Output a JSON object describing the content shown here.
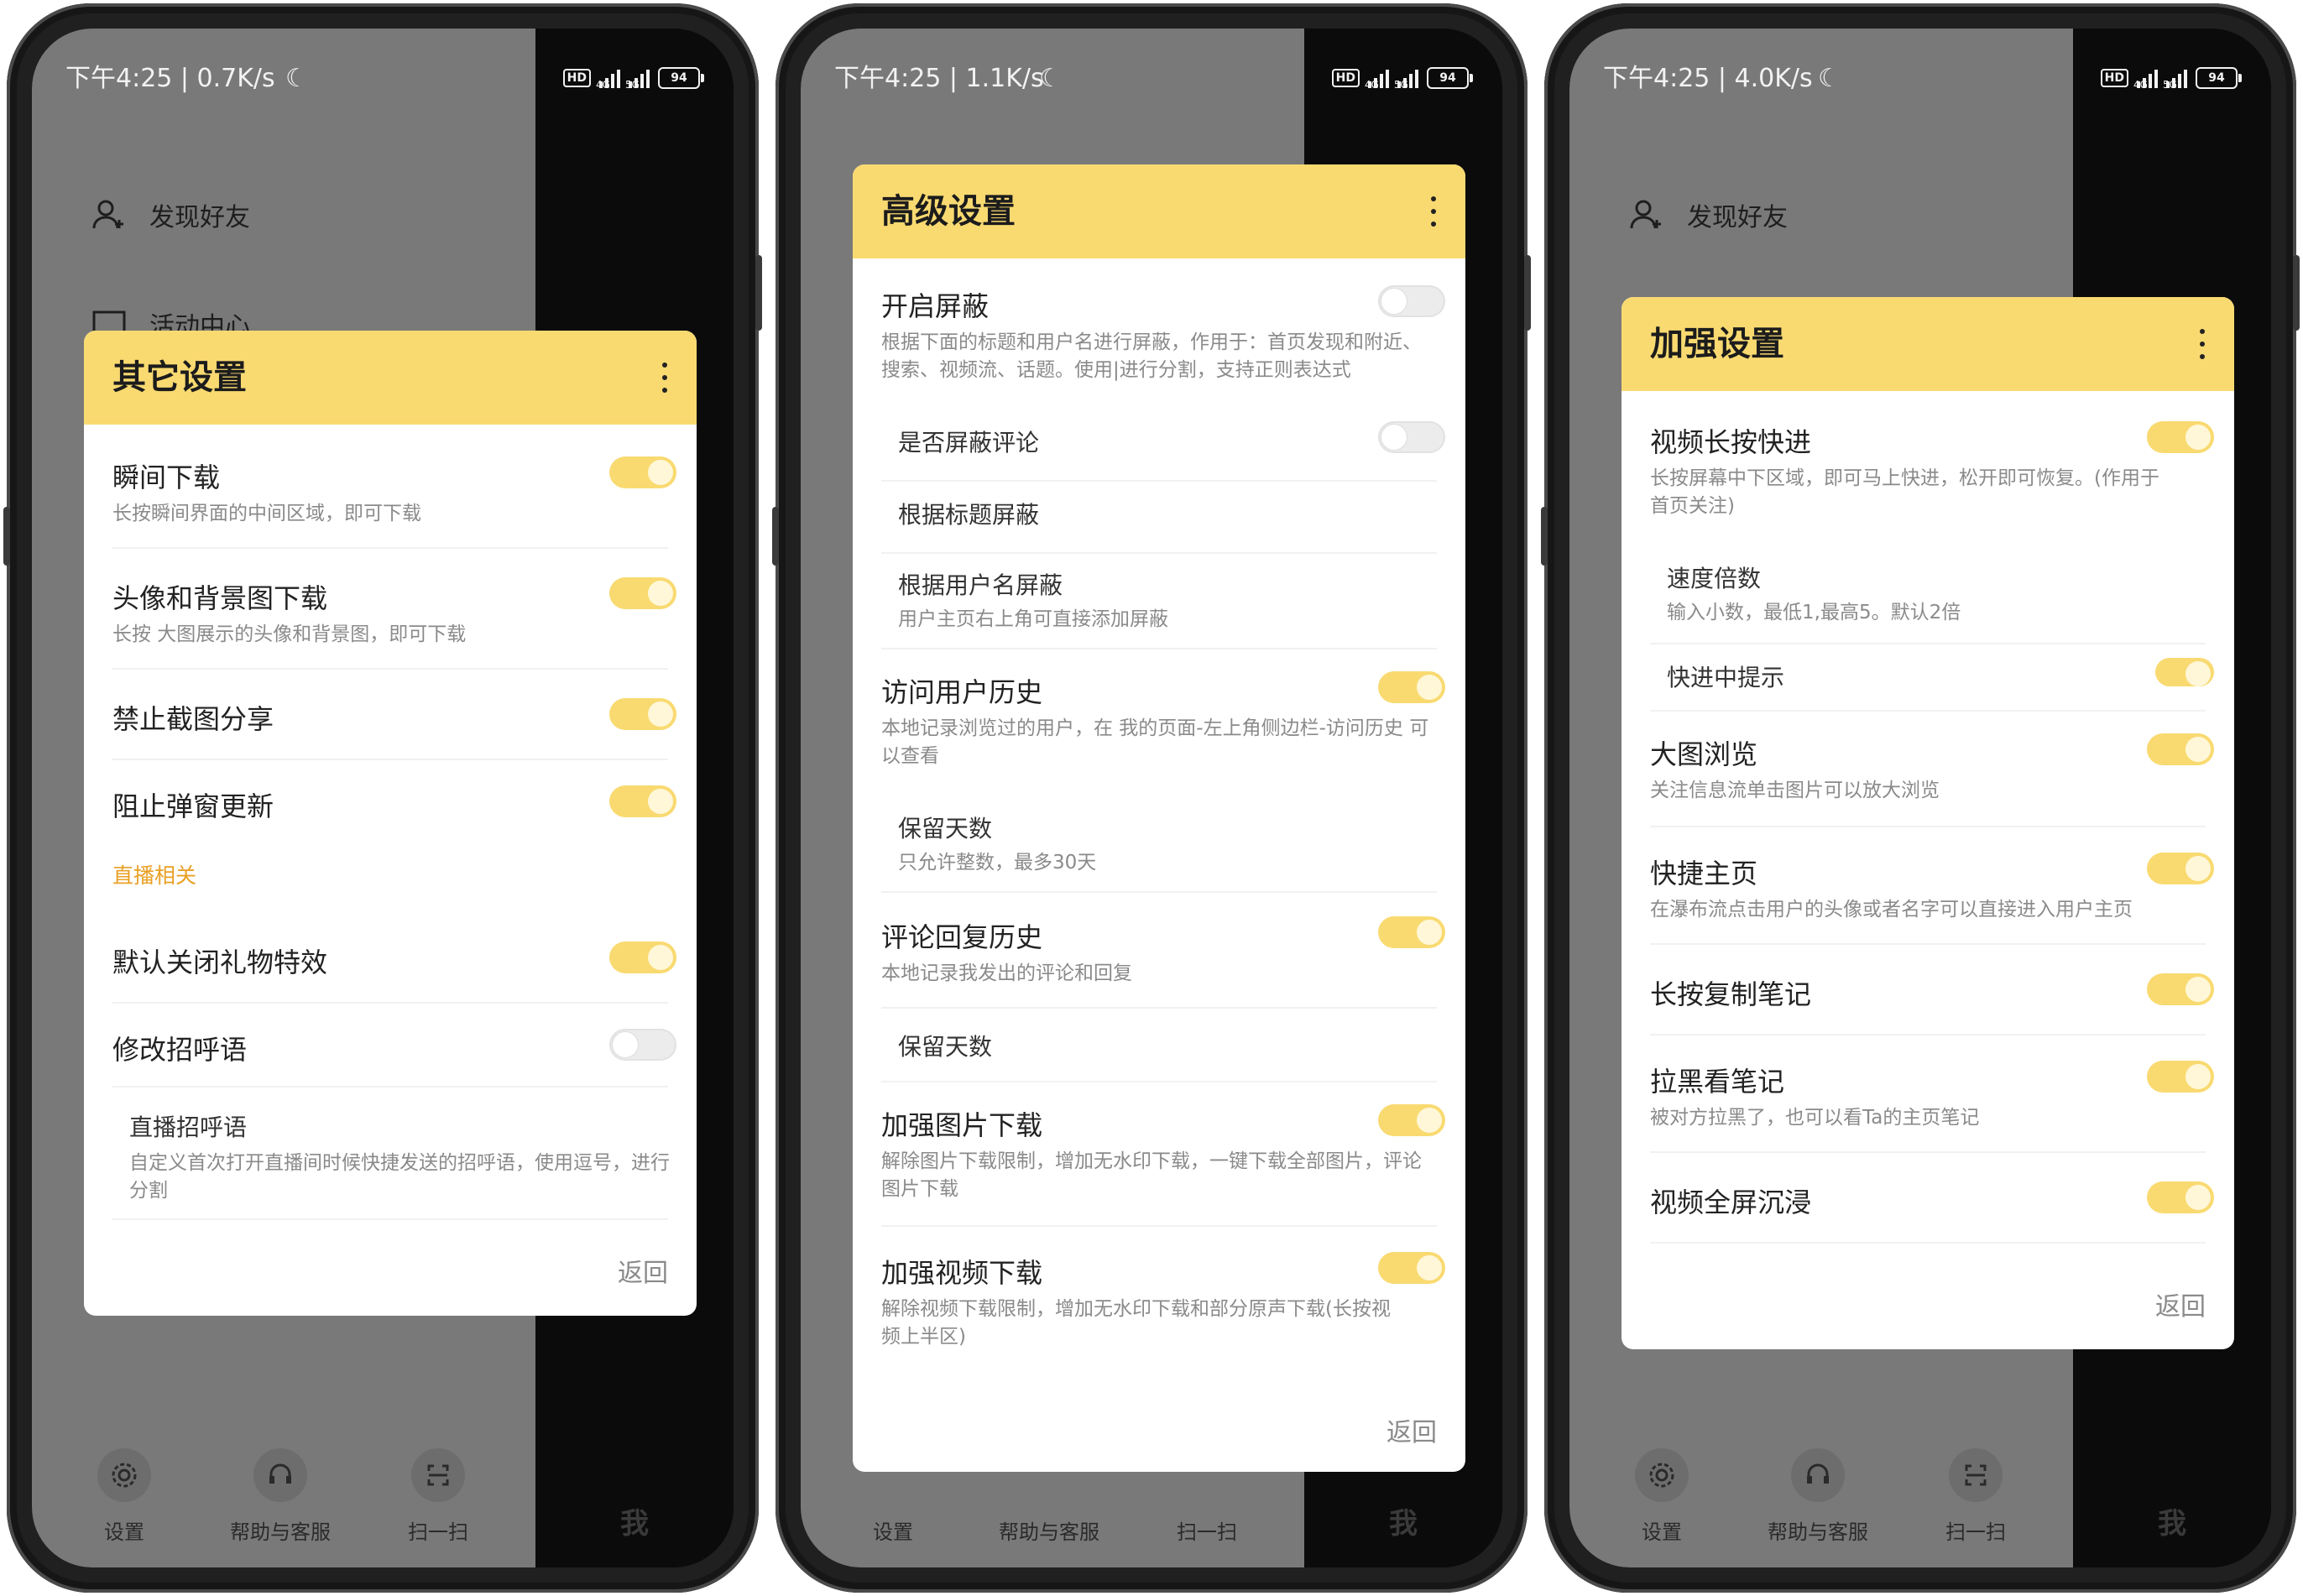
{
  "phones": [
    {
      "status": {
        "time": "下午4:25 | 0.7K/s"
      },
      "menu": [
        {
          "label": "发现好友"
        },
        {
          "label": "活动中心"
        }
      ],
      "toolbar": {
        "settings": "设置",
        "help": "帮助与客服",
        "scan": "扫一扫",
        "me": "我"
      },
      "dialog": {
        "title": "其它设置",
        "rows": [
          {
            "label": "瞬间下载",
            "desc": "长按瞬间界面的中间区域，即可下载",
            "on": true
          },
          {
            "label": "头像和背景图下载",
            "desc": "长按 大图展示的头像和背景图，即可下载",
            "on": true
          },
          {
            "label": "禁止截图分享",
            "on": true
          },
          {
            "label": "阻止弹窗更新",
            "on": true
          },
          {
            "section": "直播相关"
          },
          {
            "label": "默认关闭礼物特效",
            "on": true
          },
          {
            "label": "修改招呼语",
            "on": false
          },
          {
            "label": "直播招呼语",
            "desc": "自定义首次打开直播间时候快捷发送的招呼语，使用逗号，进行分割"
          }
        ],
        "back": "返回"
      }
    },
    {
      "status": {
        "time": "下午4:25 | 1.1K/s"
      },
      "toolbar": {
        "settings": "设置",
        "help": "帮助与客服",
        "scan": "扫一扫",
        "me": "我"
      },
      "dialog": {
        "title": "高级设置",
        "rows": [
          {
            "label": "开启屏蔽",
            "desc": "根据下面的标题和用户名进行屏蔽，作用于：首页发现和附近、搜索、视频流、话题。使用|进行分割，支持正则表达式",
            "on": false
          },
          {
            "label": "是否屏蔽评论",
            "on": false
          },
          {
            "label": "根据标题屏蔽"
          },
          {
            "label": "根据用户名屏蔽",
            "desc": "用户主页右上角可直接添加屏蔽"
          },
          {
            "label": "访问用户历史",
            "desc": "本地记录浏览过的用户，在 我的页面-左上角侧边栏-访问历史 可以查看",
            "on": true
          },
          {
            "label": "保留天数",
            "desc": "只允许整数，最多30天"
          },
          {
            "label": "评论回复历史",
            "desc": "本地记录我发出的评论和回复",
            "on": true
          },
          {
            "label": "保留天数"
          },
          {
            "label": "加强图片下载",
            "desc": "解除图片下载限制，增加无水印下载，一键下载全部图片，评论图片下载",
            "on": true
          },
          {
            "label": "加强视频下载",
            "desc": "解除视频下载限制，增加无水印下载和部分原声下载(长按视频上半区)",
            "on": true
          }
        ],
        "back": "返回"
      }
    },
    {
      "status": {
        "time": "下午4:25 | 4.0K/s"
      },
      "menu": [
        {
          "label": "发现好友"
        }
      ],
      "toolbar": {
        "settings": "设置",
        "help": "帮助与客服",
        "scan": "扫一扫",
        "me": "我"
      },
      "dialog": {
        "title": "加强设置",
        "rows": [
          {
            "label": "视频长按快进",
            "desc": "长按屏幕中下区域，即可马上快进，松开即可恢复。(作用于首页关注)",
            "on": true
          },
          {
            "label": "速度倍数",
            "desc": "输入小数，最低1,最高5。默认2倍"
          },
          {
            "label": "快进中提示",
            "on": true
          },
          {
            "label": "大图浏览",
            "desc": "关注信息流单击图片可以放大浏览",
            "on": true
          },
          {
            "label": "快捷主页",
            "desc": "在瀑布流点击用户的头像或者名字可以直接进入用户主页",
            "on": true
          },
          {
            "label": "长按复制笔记",
            "on": true
          },
          {
            "label": "拉黑看笔记",
            "desc": "被对方拉黑了，也可以看Ta的主页笔记",
            "on": true
          },
          {
            "label": "视频全屏沉浸",
            "on": true
          }
        ],
        "back": "返回"
      }
    }
  ],
  "status_icons": {
    "hd": "HD",
    "net1": "4G",
    "net2": "5G",
    "battery": "94"
  },
  "colors": {
    "accent": "#f9da71",
    "section": "#e8a025",
    "dim": "#797979"
  },
  "icons": [
    "user-plus-icon",
    "gear-icon",
    "headset-icon",
    "scan-icon",
    "more-vert-icon",
    "moon-icon"
  ]
}
